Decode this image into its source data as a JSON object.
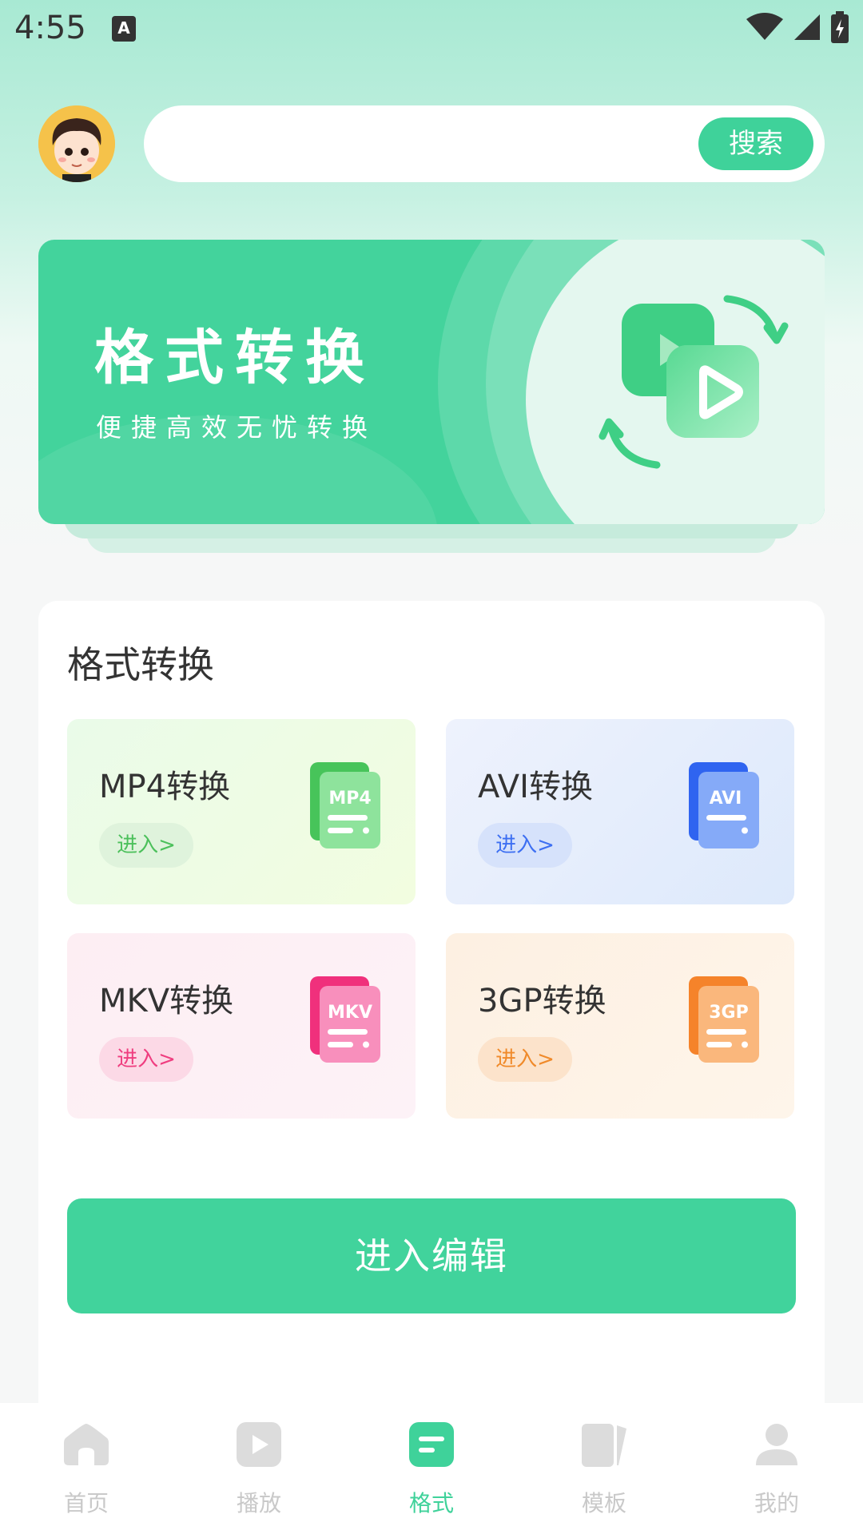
{
  "status_bar": {
    "time": "4:55",
    "notification_glyph": "A"
  },
  "header": {
    "search": {
      "placeholder": "",
      "value": "",
      "button_label": "搜索"
    }
  },
  "banner": {
    "title": "格式转换",
    "subtitle": "便捷高效无忧转换"
  },
  "section": {
    "title": "格式转换",
    "tiles": [
      {
        "label": "MP4转换",
        "enter": "进入>",
        "icon_text": "MP4",
        "color": "#4cc05b"
      },
      {
        "label": "AVI转换",
        "enter": "进入>",
        "icon_text": "AVI",
        "color": "#3d6ff2"
      },
      {
        "label": "MKV转换",
        "enter": "进入>",
        "icon_text": "MKV",
        "color": "#ef3d7f"
      },
      {
        "label": "3GP转换",
        "enter": "进入>",
        "icon_text": "3GP",
        "color": "#f08a2a"
      }
    ],
    "edit_button": "进入编辑"
  },
  "tab_bar": {
    "active_tab": "格式",
    "tabs": [
      {
        "label": "首页",
        "icon": "home-icon"
      },
      {
        "label": "播放",
        "icon": "play-icon"
      },
      {
        "label": "格式",
        "icon": "format-icon"
      },
      {
        "label": "模板",
        "icon": "template-icon"
      },
      {
        "label": "我的",
        "icon": "profile-icon"
      }
    ]
  },
  "colors": {
    "accent": "#3fd29a",
    "tab_inactive": "#c9c9c9"
  }
}
